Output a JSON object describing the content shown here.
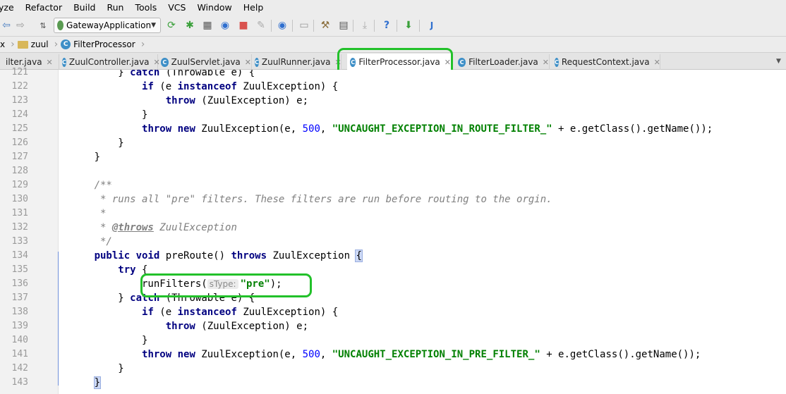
{
  "menu": [
    "yze",
    "Refactor",
    "Build",
    "Run",
    "Tools",
    "VCS",
    "Window",
    "Help"
  ],
  "toolbar": {
    "run_config": "GatewayApplication"
  },
  "breadcrumb": [
    "x",
    "zuul",
    "FilterProcessor"
  ],
  "tabs": [
    {
      "label": "ilter.java"
    },
    {
      "label": "ZuulController.java"
    },
    {
      "label": "ZuulServlet.java"
    },
    {
      "label": "ZuulRunner.java"
    },
    {
      "label": "FilterProcessor.java"
    },
    {
      "label": "FilterLoader.java"
    },
    {
      "label": "RequestContext.java"
    }
  ],
  "editor": {
    "line_numbers": [
      "121",
      "122",
      "123",
      "124",
      "125",
      "126",
      "127",
      "128",
      "129",
      "130",
      "131",
      "132",
      "133",
      "134",
      "135",
      "136",
      "137",
      "138",
      "139",
      "140",
      "141",
      "142",
      "143"
    ],
    "parameter_hint": "sType:",
    "strings": {
      "route_filter": "\"UNCAUGHT_EXCEPTION_IN_ROUTE_FILTER_\"",
      "pre_filter": "\"UNCAUGHT_EXCEPTION_IN_PRE_FILTER_\"",
      "pre": "\"pre\""
    },
    "status_code": "500",
    "javadoc_text": "* runs all \"pre\" filters. These filters are run before routing to the orgin."
  },
  "colors": {
    "highlight": "#22c12a",
    "keyword": "#000080",
    "string": "#008000"
  }
}
